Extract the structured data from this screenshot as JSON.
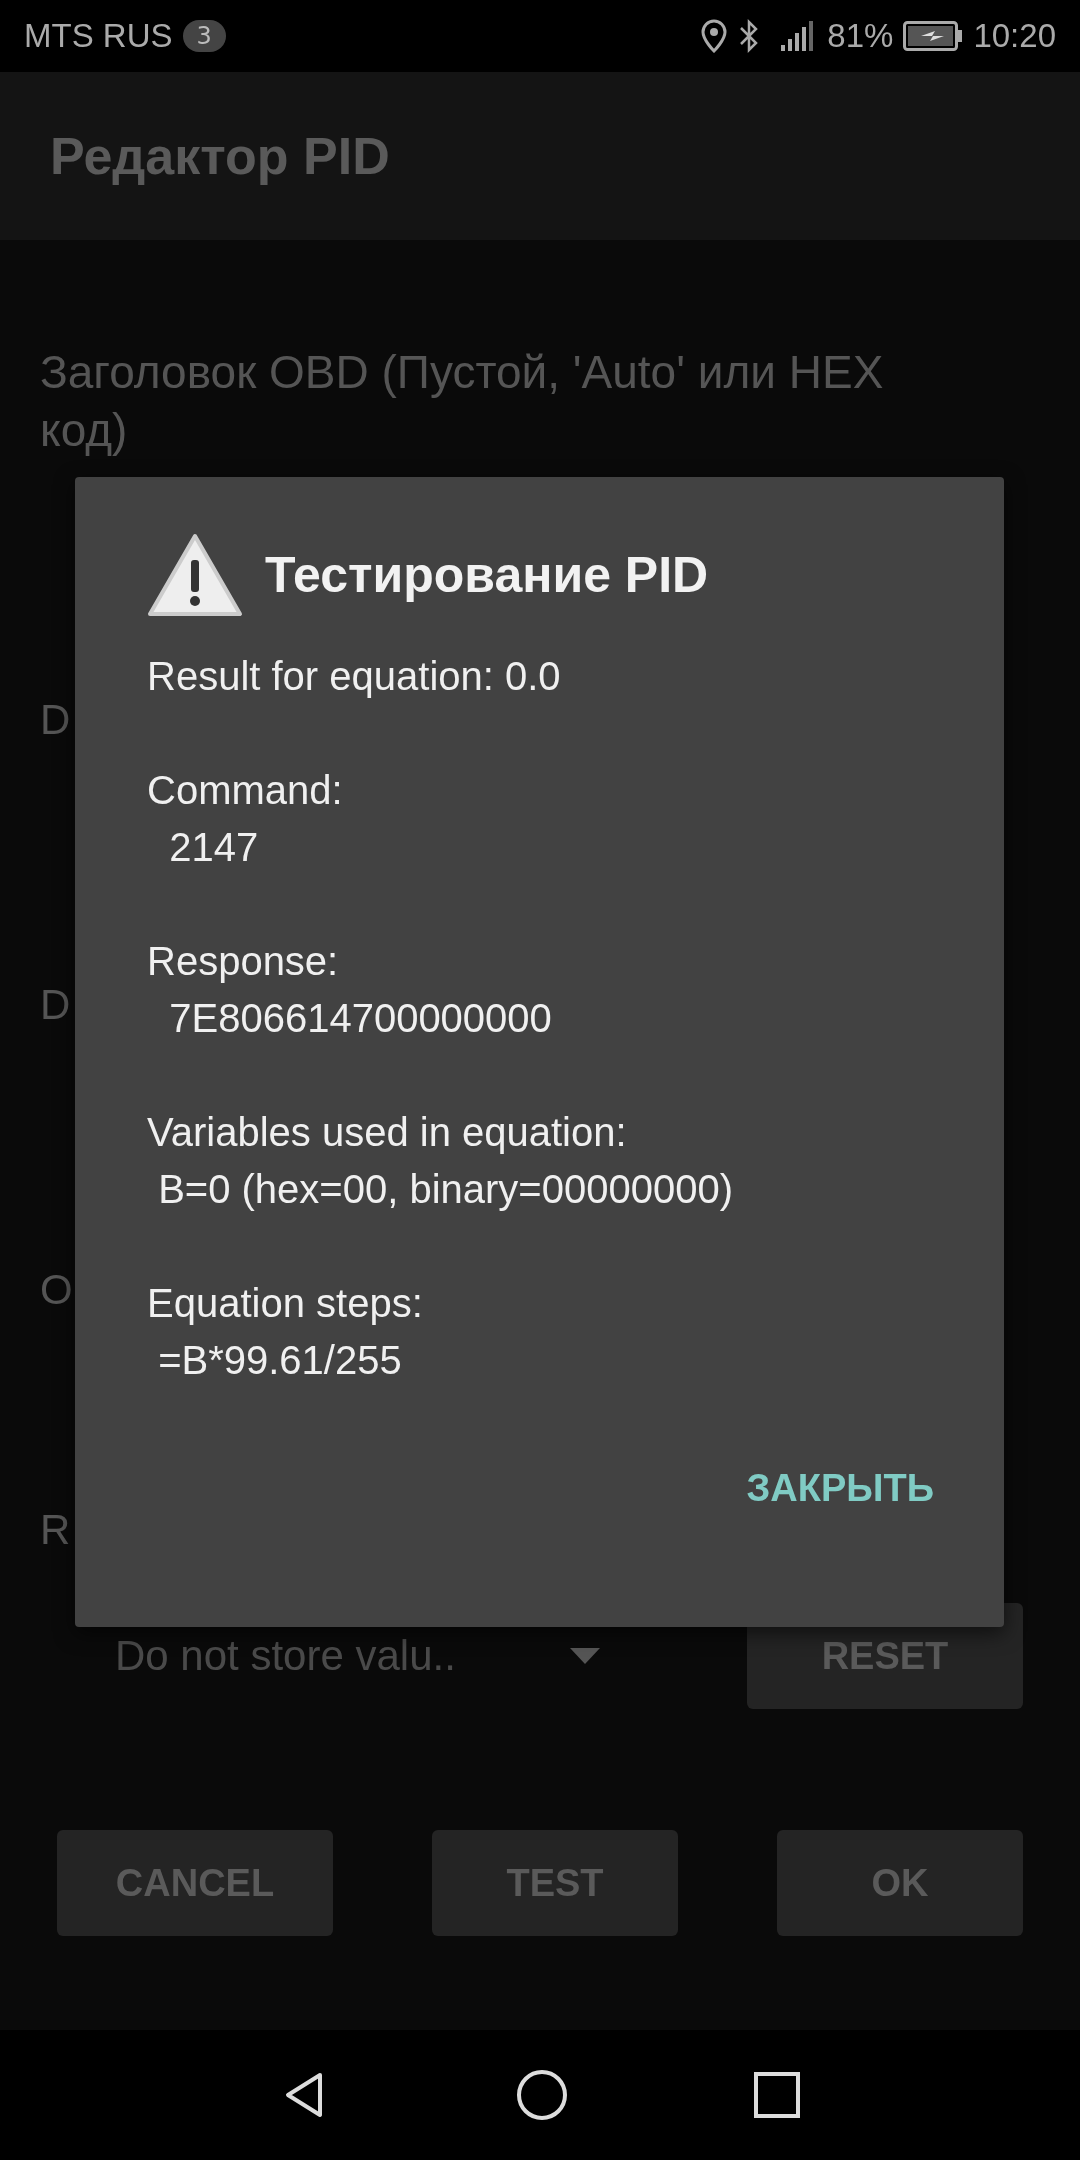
{
  "status_bar": {
    "carrier": "MTS RUS",
    "notification_count": "3",
    "battery": "81%",
    "time": "10:20"
  },
  "app_bar": {
    "title": "Редактор PID"
  },
  "form": {
    "header_label": "Заголовок OBD (Пустой, 'Auto' или HEX код)",
    "partial_labels": [
      "D",
      "D",
      "O",
      "R"
    ],
    "store_spinner": {
      "value": "Do not store valu.."
    },
    "reset_button": "RESET",
    "buttons": [
      "CANCEL",
      "TEST",
      "OK"
    ]
  },
  "dialog": {
    "title": "Тестирование PID",
    "message": "Result for equation: 0.0\n\nCommand:\n  2147\n\nResponse:\n  7E806614700000000\n\nVariables used in equation:\n B=0 (hex=00, binary=00000000)\n\nEquation steps:\n =B*99.61/255",
    "close_button": "ЗАКРЫТЬ"
  }
}
